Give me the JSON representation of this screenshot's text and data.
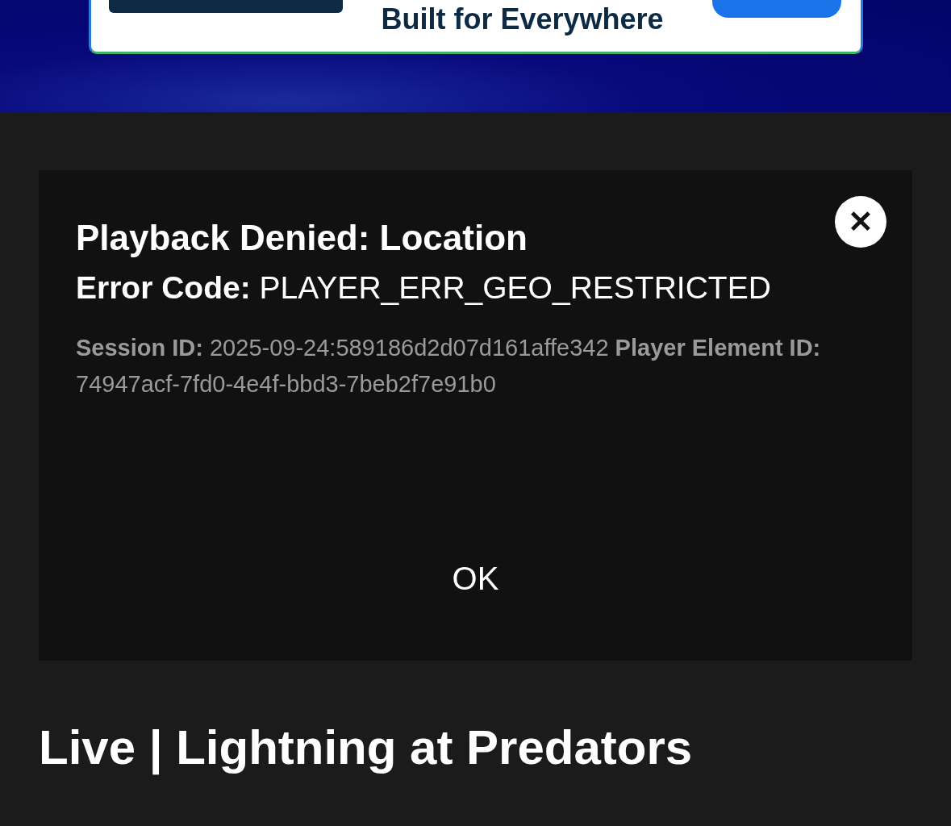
{
  "ad_banner": {
    "tagline": "Built for Everywhere"
  },
  "dialog": {
    "title": "Playback Denied: Location",
    "error_code": "**Error Code:** PLAYER_ERR_GEO_RESTRICTED",
    "details": "**Session ID:** 2025-09-24:589186d2d07d161affe342 **Player Element ID:** 74947acf-7fd0-4e4f-bbd3-7beb2f7e91b0",
    "close": "✕",
    "button": "OK"
  },
  "page_title": "Live | Lightning at Predators"
}
